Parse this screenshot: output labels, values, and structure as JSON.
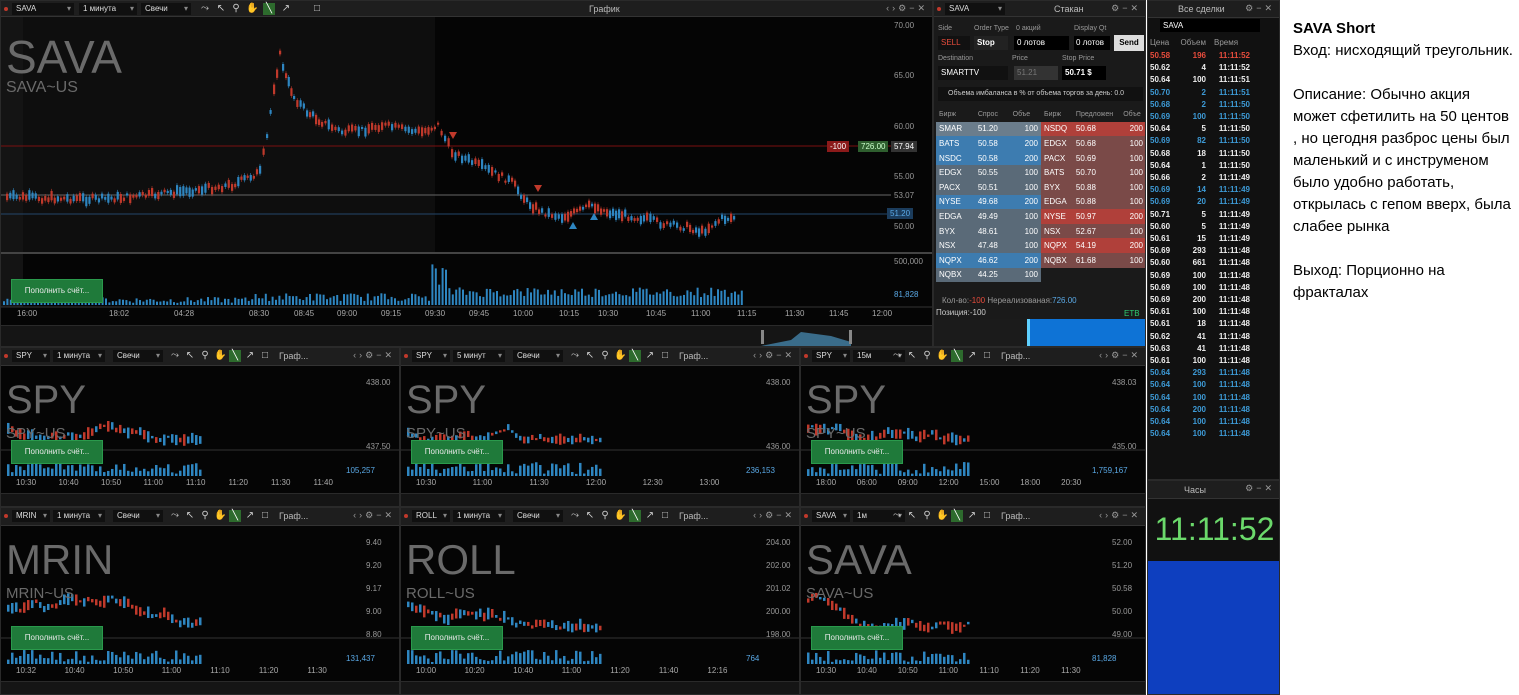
{
  "main_chart": {
    "symbol": "SAVA",
    "timeframe": "1 минута",
    "chart_type": "Свечи",
    "title": "График",
    "big_symbol": "SAVA",
    "sub_symbol": "SAVA~US",
    "button": "Пополнить счёт...",
    "y_ticks": [
      "70.00",
      "65.00",
      "60.00",
      "55.00",
      "53.07",
      "51.20",
      "50.00"
    ],
    "vol_ticks": [
      "500,000",
      "81,828"
    ],
    "x_ticks": [
      "16:00",
      "18:02",
      "04:28",
      "08:30",
      "08:45",
      "09:00",
      "09:15",
      "09:30",
      "09:45",
      "10:00",
      "10:15",
      "10:30",
      "10:45",
      "11:00",
      "11:15",
      "11:30",
      "11:45",
      "12:00"
    ],
    "order_qty": "-100",
    "order_price": "726.00",
    "order_level": "57.94"
  },
  "order_panel": {
    "symbol": "SAVA",
    "title": "Стакан",
    "side_label": "Side",
    "side": "SELL",
    "order_type_label": "Order Type",
    "order_type": "Stop",
    "qty_label": "0 акций",
    "qty": "0 лотов",
    "display_label": "Display Qt",
    "display": "0 лотов",
    "send": "Send",
    "dest_label": "Destination",
    "dest": "SMARTTV",
    "price_label": "Price",
    "price": "51.21",
    "stop_label": "Stop Price",
    "stop": "50.71 $",
    "imbalance": "Объема имбаланса в % от объема торгов за день: 0.0",
    "bid_headers": [
      "Бирж",
      "Спрос",
      "Объе"
    ],
    "ask_headers": [
      "Бирж",
      "Предложен",
      "Объе"
    ],
    "bids": [
      [
        "SMAR",
        "51.20",
        "100"
      ],
      [
        "BATS",
        "50.58",
        "200"
      ],
      [
        "NSDC",
        "50.58",
        "200"
      ],
      [
        "EDGX",
        "50.55",
        "100"
      ],
      [
        "PACX",
        "50.51",
        "100"
      ],
      [
        "NYSE",
        "49.68",
        "200"
      ],
      [
        "EDGA",
        "49.49",
        "100"
      ],
      [
        "BYX",
        "48.61",
        "100"
      ],
      [
        "NSX",
        "47.48",
        "100"
      ],
      [
        "NQPX",
        "46.62",
        "200"
      ],
      [
        "NQBX",
        "44.25",
        "100"
      ]
    ],
    "asks": [
      [
        "NSDQ",
        "50.68",
        "200"
      ],
      [
        "EDGX",
        "50.68",
        "100"
      ],
      [
        "PACX",
        "50.69",
        "100"
      ],
      [
        "BATS",
        "50.70",
        "100"
      ],
      [
        "BYX",
        "50.88",
        "100"
      ],
      [
        "EDGA",
        "50.88",
        "100"
      ],
      [
        "NYSE",
        "50.97",
        "200"
      ],
      [
        "NSX",
        "52.67",
        "100"
      ],
      [
        "NQPX",
        "54.19",
        "200"
      ],
      [
        "NQBX",
        "61.68",
        "100"
      ]
    ],
    "qty_text": "Кол-во:",
    "qty_val": "-100",
    "pnl_text": "Нереализованая:",
    "pnl_val": "726.00",
    "et": "ETB",
    "position": "Позиция:-100"
  },
  "trades": {
    "title": "Все сделки",
    "symbol": "SAVA",
    "headers": [
      "Цена",
      "Объем",
      "Время"
    ],
    "rows": [
      [
        "50.58",
        "196",
        "11:11:52",
        "r"
      ],
      [
        "50.62",
        "4",
        "11:11:52",
        "w"
      ],
      [
        "50.64",
        "100",
        "11:11:51",
        "w"
      ],
      [
        "50.70",
        "2",
        "11:11:51",
        "b"
      ],
      [
        "50.68",
        "2",
        "11:11:50",
        "b"
      ],
      [
        "50.69",
        "100",
        "11:11:50",
        "b"
      ],
      [
        "50.64",
        "5",
        "11:11:50",
        "w"
      ],
      [
        "50.69",
        "82",
        "11:11:50",
        "b"
      ],
      [
        "50.68",
        "18",
        "11:11:50",
        "w"
      ],
      [
        "50.64",
        "1",
        "11:11:50",
        "w"
      ],
      [
        "50.66",
        "2",
        "11:11:49",
        "w"
      ],
      [
        "50.69",
        "14",
        "11:11:49",
        "b"
      ],
      [
        "50.69",
        "20",
        "11:11:49",
        "b"
      ],
      [
        "50.71",
        "5",
        "11:11:49",
        "w"
      ],
      [
        "50.60",
        "5",
        "11:11:49",
        "w"
      ],
      [
        "50.61",
        "15",
        "11:11:49",
        "w"
      ],
      [
        "50.69",
        "293",
        "11:11:48",
        "w"
      ],
      [
        "50.60",
        "661",
        "11:11:48",
        "w"
      ],
      [
        "50.69",
        "100",
        "11:11:48",
        "w"
      ],
      [
        "50.69",
        "100",
        "11:11:48",
        "w"
      ],
      [
        "50.69",
        "200",
        "11:11:48",
        "w"
      ],
      [
        "50.61",
        "100",
        "11:11:48",
        "w"
      ],
      [
        "50.61",
        "18",
        "11:11:48",
        "w"
      ],
      [
        "50.62",
        "41",
        "11:11:48",
        "w"
      ],
      [
        "50.63",
        "41",
        "11:11:48",
        "w"
      ],
      [
        "50.61",
        "100",
        "11:11:48",
        "w"
      ],
      [
        "50.64",
        "293",
        "11:11:48",
        "b"
      ],
      [
        "50.64",
        "100",
        "11:11:48",
        "b"
      ],
      [
        "50.64",
        "100",
        "11:11:48",
        "b"
      ],
      [
        "50.64",
        "200",
        "11:11:48",
        "b"
      ],
      [
        "50.64",
        "100",
        "11:11:48",
        "b"
      ],
      [
        "50.64",
        "100",
        "11:11:48",
        "b"
      ]
    ]
  },
  "clock": {
    "title": "Часы",
    "time": "11:11:52"
  },
  "small_charts": [
    {
      "symbol": "SPY",
      "tf": "1 минута",
      "type": "Свечи",
      "title": "Граф...",
      "big": "SPY",
      "sub": "SPY~US",
      "button": "Пополнить счёт...",
      "y": [
        "438.00",
        "437.50"
      ],
      "vol": "105,257",
      "x": [
        "10:30",
        "10:40",
        "10:50",
        "11:00",
        "11:10",
        "11:20",
        "11:30",
        "11:40"
      ]
    },
    {
      "symbol": "SPY",
      "tf": "5 минут",
      "type": "Свечи",
      "title": "Граф...",
      "big": "SPY",
      "sub": "SPY~US",
      "button": "Пополнить счёт...",
      "y": [
        "438.00",
        "436.00"
      ],
      "vol": "236,153",
      "x": [
        "10:30",
        "11:00",
        "11:30",
        "12:00",
        "12:30",
        "13:00"
      ]
    },
    {
      "symbol": "SPY",
      "tf": "15м",
      "type": "",
      "title": "Граф...",
      "big": "SPY",
      "sub": "SPY~US",
      "button": "Пополнить счёт...",
      "y": [
        "438.03",
        "435.00"
      ],
      "vol": "1,759,167",
      "x": [
        "18:00",
        "06:00",
        "09:00",
        "12:00",
        "15:00",
        "18:00",
        "20:30"
      ]
    },
    {
      "symbol": "MRIN",
      "tf": "1 минута",
      "type": "Свечи",
      "title": "Граф...",
      "big": "MRIN",
      "sub": "MRIN~US",
      "button": "Пополнить счёт...",
      "y": [
        "9.40",
        "9.20",
        "9.17",
        "9.00",
        "8.80"
      ],
      "vol": "131,437",
      "x": [
        "10:32",
        "10:40",
        "10:50",
        "11:00",
        "11:10",
        "11:20",
        "11:30"
      ]
    },
    {
      "symbol": "ROLL",
      "tf": "1 минута",
      "type": "Свечи",
      "title": "Граф...",
      "big": "ROLL",
      "sub": "ROLL~US",
      "button": "Пополнить счёт...",
      "y": [
        "204.00",
        "202.00",
        "201.02",
        "200.00",
        "198.00"
      ],
      "vol": "764",
      "x": [
        "10:00",
        "10:20",
        "10:40",
        "11:00",
        "11:20",
        "11:40",
        "12:16"
      ]
    },
    {
      "symbol": "SAVA",
      "tf": "1м",
      "type": "",
      "title": "Граф...",
      "big": "SAVA",
      "sub": "SAVA~US",
      "button": "Пополнить счёт...",
      "y": [
        "52.00",
        "51.20",
        "50.58",
        "50.00",
        "49.00"
      ],
      "vol": "81,828",
      "x": [
        "10:30",
        "10:40",
        "10:50",
        "11:00",
        "11:10",
        "11:20",
        "11:30"
      ]
    }
  ],
  "note": {
    "title": "SAVA Short",
    "entry": "Вход: нисходящий треугольник.",
    "desc": "Описание: Обычно акция может сфетилить на 50 центов , но цегодня разброс цены был маленький и с инструменом было удобно работать, открылась с гепом вверх, была слабее рынка",
    "exit": "Выход: Порционно на фракталах"
  },
  "colors": {
    "up": "#2e86c1",
    "down": "#c0392b",
    "btn": "#1f7a3a"
  }
}
